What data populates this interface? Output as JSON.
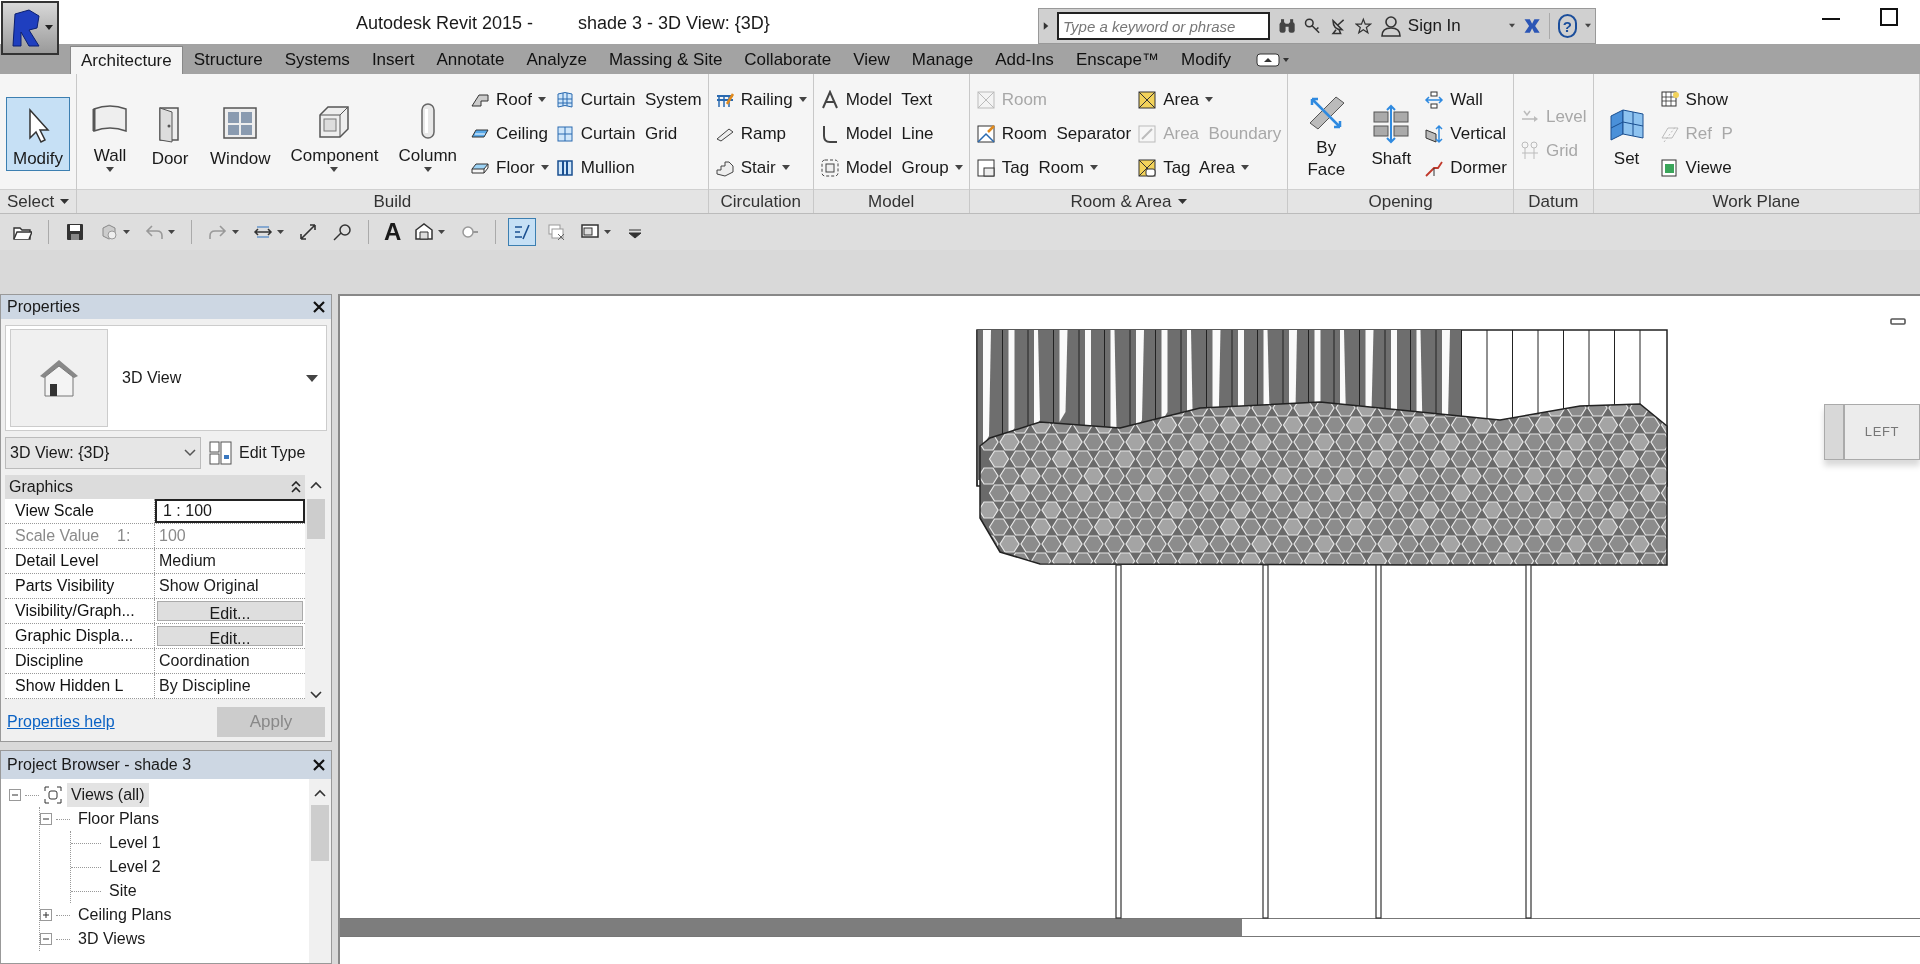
{
  "title_bar": {
    "app_title": "Autodesk Revit 2015 -",
    "document_title": "shade 3 - 3D View: {3D}"
  },
  "infocenter": {
    "search_placeholder": "Type a keyword or phrase",
    "sign_in": "Sign In",
    "help": "?"
  },
  "ribbon_tabs": [
    {
      "label": "Architecture",
      "selected": true
    },
    {
      "label": "Structure",
      "selected": false
    },
    {
      "label": "Systems",
      "selected": false
    },
    {
      "label": "Insert",
      "selected": false
    },
    {
      "label": "Annotate",
      "selected": false
    },
    {
      "label": "Analyze",
      "selected": false
    },
    {
      "label": "Massing & Site",
      "selected": false
    },
    {
      "label": "Collaborate",
      "selected": false
    },
    {
      "label": "View",
      "selected": false
    },
    {
      "label": "Manage",
      "selected": false
    },
    {
      "label": "Add-Ins",
      "selected": false
    },
    {
      "label": "Enscape™",
      "selected": false
    },
    {
      "label": "Modify",
      "selected": false
    }
  ],
  "ribbon_panels": [
    {
      "title": "Select",
      "title_dropdown": true,
      "columns": [
        {
          "tools": [
            {
              "kind": "large",
              "label": "Modify",
              "selected": true,
              "disabled": false,
              "dropdown": false
            }
          ]
        }
      ]
    },
    {
      "title": "Build",
      "title_dropdown": false,
      "columns": [
        {
          "tools": [
            {
              "kind": "large",
              "label": "Wall",
              "selected": false,
              "disabled": false,
              "dropdown": true
            }
          ]
        },
        {
          "tools": [
            {
              "kind": "large",
              "label": "Door",
              "selected": false,
              "disabled": false,
              "dropdown": false
            }
          ]
        },
        {
          "tools": [
            {
              "kind": "large",
              "label": "Window",
              "selected": false,
              "disabled": false,
              "dropdown": false
            }
          ]
        },
        {
          "tools": [
            {
              "kind": "large",
              "label": "Component",
              "selected": false,
              "disabled": false,
              "dropdown": true
            }
          ]
        },
        {
          "tools": [
            {
              "kind": "large",
              "label": "Column",
              "selected": false,
              "disabled": false,
              "dropdown": true
            }
          ]
        },
        {
          "tools": [
            {
              "kind": "small",
              "label": "Roof",
              "selected": false,
              "disabled": false,
              "dropdown": true
            },
            {
              "kind": "small",
              "label": "Ceiling",
              "selected": false,
              "disabled": false,
              "dropdown": false
            },
            {
              "kind": "small",
              "label": "Floor",
              "selected": false,
              "disabled": false,
              "dropdown": true
            }
          ]
        },
        {
          "tools": [
            {
              "kind": "small",
              "label": "Curtain System",
              "selected": false,
              "disabled": false,
              "dropdown": false
            },
            {
              "kind": "small",
              "label": "Curtain Grid",
              "selected": false,
              "disabled": false,
              "dropdown": false
            },
            {
              "kind": "small",
              "label": "Mullion",
              "selected": false,
              "disabled": false,
              "dropdown": false
            }
          ]
        }
      ]
    },
    {
      "title": "Circulation",
      "title_dropdown": false,
      "columns": [
        {
          "tools": [
            {
              "kind": "small",
              "label": "Railing",
              "selected": false,
              "disabled": false,
              "dropdown": true
            },
            {
              "kind": "small",
              "label": "Ramp",
              "selected": false,
              "disabled": false,
              "dropdown": false
            },
            {
              "kind": "small",
              "label": "Stair",
              "selected": false,
              "disabled": false,
              "dropdown": true
            }
          ]
        }
      ]
    },
    {
      "title": "Model",
      "title_dropdown": false,
      "columns": [
        {
          "tools": [
            {
              "kind": "small",
              "label": "Model Text",
              "selected": false,
              "disabled": false,
              "dropdown": false
            },
            {
              "kind": "small",
              "label": "Model Line",
              "selected": false,
              "disabled": false,
              "dropdown": false
            },
            {
              "kind": "small",
              "label": "Model Group",
              "selected": false,
              "disabled": false,
              "dropdown": true
            }
          ]
        }
      ]
    },
    {
      "title": "Room & Area",
      "title_dropdown": true,
      "columns": [
        {
          "tools": [
            {
              "kind": "small",
              "label": "Room",
              "selected": false,
              "disabled": true,
              "dropdown": false
            },
            {
              "kind": "small",
              "label": "Room Separator",
              "selected": false,
              "disabled": false,
              "dropdown": false
            },
            {
              "kind": "small",
              "label": "Tag Room",
              "selected": false,
              "disabled": false,
              "dropdown": true
            }
          ]
        },
        {
          "tools": [
            {
              "kind": "small",
              "label": "Area",
              "selected": false,
              "disabled": false,
              "dropdown": true
            },
            {
              "kind": "small",
              "label": "Area Boundary",
              "selected": false,
              "disabled": true,
              "dropdown": false
            },
            {
              "kind": "small",
              "label": "Tag Area",
              "selected": false,
              "disabled": false,
              "dropdown": true
            }
          ]
        }
      ]
    },
    {
      "title": "Opening",
      "title_dropdown": false,
      "columns": [
        {
          "tools": [
            {
              "kind": "large",
              "label": "By Face",
              "selected": false,
              "disabled": false,
              "dropdown": false
            }
          ]
        },
        {
          "tools": [
            {
              "kind": "large",
              "label": "Shaft",
              "selected": false,
              "disabled": false,
              "dropdown": false
            }
          ]
        },
        {
          "tools": [
            {
              "kind": "small",
              "label": "Wall",
              "selected": false,
              "disabled": false,
              "dropdown": false
            },
            {
              "kind": "small",
              "label": "Vertical",
              "selected": false,
              "disabled": false,
              "dropdown": false
            },
            {
              "kind": "small",
              "label": "Dormer",
              "selected": false,
              "disabled": false,
              "dropdown": false
            }
          ]
        }
      ]
    },
    {
      "title": "Datum",
      "title_dropdown": false,
      "columns": [
        {
          "tools": [
            {
              "kind": "small",
              "label": "Level",
              "selected": false,
              "disabled": true,
              "dropdown": false
            },
            {
              "kind": "small",
              "label": "Grid",
              "selected": false,
              "disabled": true,
              "dropdown": false
            }
          ]
        }
      ]
    },
    {
      "title": "Work Plane",
      "title_dropdown": false,
      "columns": [
        {
          "tools": [
            {
              "kind": "large",
              "label": "Set",
              "selected": false,
              "disabled": false,
              "dropdown": false
            }
          ]
        },
        {
          "tools": [
            {
              "kind": "small",
              "label": "Show",
              "selected": false,
              "disabled": false,
              "dropdown": false
            },
            {
              "kind": "small",
              "label": "Ref P",
              "selected": false,
              "disabled": true,
              "dropdown": false
            },
            {
              "kind": "small",
              "label": "Viewe",
              "selected": false,
              "disabled": false,
              "dropdown": false
            }
          ]
        }
      ]
    }
  ],
  "quick_access": [
    {
      "kind": "icon",
      "selected": false,
      "dropdown": false
    },
    {
      "kind": "icon",
      "selected": false,
      "dropdown": false
    },
    {
      "kind": "icon",
      "selected": false,
      "dropdown": true
    },
    {
      "kind": "icon",
      "selected": false,
      "dropdown": true
    },
    {
      "kind": "icon",
      "selected": false,
      "dropdown": true
    },
    {
      "kind": "icon",
      "selected": false,
      "dropdown": true
    },
    {
      "kind": "icon",
      "selected": false,
      "dropdown": false
    },
    {
      "kind": "icon",
      "selected": false,
      "dropdown": false
    },
    {
      "kind": "glyph",
      "text": "A",
      "selected": false,
      "dropdown": false
    },
    {
      "kind": "icon",
      "selected": false,
      "dropdown": true
    },
    {
      "kind": "icon",
      "selected": false,
      "dropdown": false
    },
    {
      "kind": "icon",
      "selected": true,
      "dropdown": false
    },
    {
      "kind": "icon",
      "selected": false,
      "dropdown": false
    },
    {
      "kind": "icon",
      "selected": false,
      "dropdown": true
    },
    {
      "kind": "icon",
      "selected": false,
      "dropdown": false
    }
  ],
  "properties": {
    "title": "Properties",
    "type_name": "3D View",
    "instance": "3D View: {3D}",
    "edit_type": "Edit Type",
    "group": "Graphics",
    "rows": [
      {
        "label": "View Scale",
        "value": "1 : 100",
        "kind": "input"
      },
      {
        "label": "Scale Value    1:",
        "value": "100",
        "kind": "readonly"
      },
      {
        "label": "Detail Level",
        "value": "Medium",
        "kind": "text"
      },
      {
        "label": "Parts Visibility",
        "value": "Show Original",
        "kind": "text"
      },
      {
        "label": "Visibility/Graph...",
        "value": "Edit...",
        "kind": "button"
      },
      {
        "label": "Graphic Displa...",
        "value": "Edit...",
        "kind": "button"
      },
      {
        "label": "Discipline",
        "value": "Coordination",
        "kind": "text"
      },
      {
        "label": "Show Hidden L",
        "value": "By Discipline",
        "kind": "text"
      }
    ],
    "help_link": "Properties help",
    "apply": "Apply"
  },
  "project_browser": {
    "title": "Project Browser - shade 3",
    "tree": [
      {
        "label": "Views (all)",
        "selected": true,
        "expanded": true,
        "children": [
          {
            "label": "Floor Plans",
            "selected": false,
            "expanded": true,
            "children": [
              {
                "label": "Level 1",
                "selected": false
              },
              {
                "label": "Level 2",
                "selected": false
              },
              {
                "label": "Site",
                "selected": false
              }
            ]
          },
          {
            "label": "Ceiling Plans",
            "selected": false,
            "expanded": false
          },
          {
            "label": "3D Views",
            "selected": false,
            "expanded": true
          }
        ]
      }
    ]
  },
  "viewport": {
    "viewcube_face": "LEFT"
  }
}
